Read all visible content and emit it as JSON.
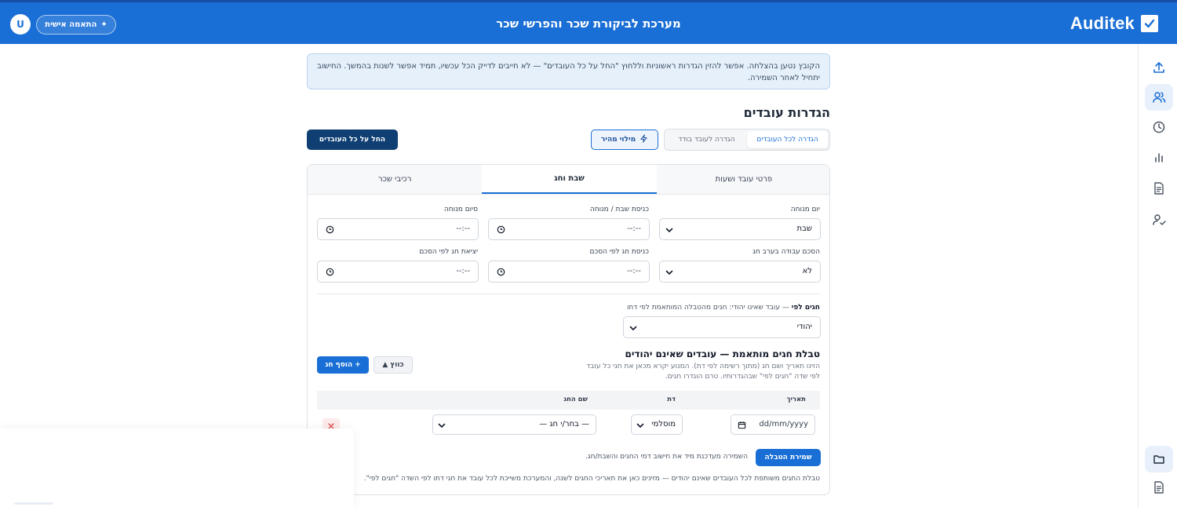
{
  "header": {
    "brand": "Auditek",
    "title": "מערכת לביקורת שכר והפרשי שכר",
    "personal_button": "התאמה אישית",
    "avatar_initial": "U"
  },
  "alert": {
    "text": "הקובץ נטען בהצלחה. אפשר להזין הגדרות ראשוניות וללחוץ \"החל על כל העובדים\" — לא חייבים לדייק הכל עכשיו, תמיד אפשר לשנות בהמשך. החישוב יתחיל לאחר השמירה."
  },
  "page": {
    "title": "הגדרות עובדים",
    "mode_tabs": [
      "הגדרה לכל העובדים",
      "הגדרה לעובד בודד"
    ],
    "quick_fill": "מילוי מהיר",
    "apply_all": "החל על כל העובדים"
  },
  "tabs": [
    "פרטי עובד ושעות",
    "שבת וחג",
    "רכיבי שכר"
  ],
  "fields": {
    "rest_day": {
      "label": "יום מנוחה",
      "value": "שבת"
    },
    "shabbat_entry": {
      "label": "כניסת שבת / מנוחה",
      "value": "--:--"
    },
    "rest_end": {
      "label": "סיום מנוחה",
      "value": "--:--"
    },
    "eve_work": {
      "label": "הסכם עבודה בערב חג",
      "value": "לא"
    },
    "holiday_entry": {
      "label": "כניסת חג לפי הסכם",
      "value": "--:--"
    },
    "holiday_exit": {
      "label": "יציאת חג לפי הסכם",
      "value": "--:--"
    }
  },
  "holidays_by": {
    "label_bold": "חגים לפי",
    "label_rest": " — עובד שאינו יהודי: חגים מהטבלה המותאמת לפי דתו",
    "value": "יהודי"
  },
  "custom_table": {
    "title": "טבלת חגים מותאמת — עובדים שאינם יהודים",
    "description": "הזינו תאריך ושם חג (מתוך רשימה לפי דת). המנוע יקרא מכאן את חגי כל עובד לפי שדה \"חגים לפי\" שבהגדרותיו. טרם הוגדרו חגים.",
    "collapse": "כווץ",
    "add": "הוסף חג",
    "columns": [
      "תאריך",
      "דת",
      "שם החג"
    ],
    "row": {
      "date": "dd/mm/yyyy",
      "religion": "מוסלמי",
      "holiday": "— בחר/י חג —"
    },
    "save": "שמירת הטבלה",
    "save_note": "השמירה מעדכנת מיד את חישוב דמי החגים והשבת/חג.",
    "footer": "טבלת החגים משותפת לכל העובדים שאינם יהודים — מזינים כאן את תאריכי החגים לשנה, והמערכת משייכת לכל עובד את חגי דתו לפי השדה \"חגים לפי\"."
  },
  "rail": {
    "icons": [
      "upload-icon",
      "users-icon",
      "clock-icon",
      "bar-chart-icon",
      "document-icon",
      "user-check-icon",
      "folder-icon",
      "file-icon"
    ],
    "active": "users-icon"
  },
  "colors": {
    "primary": "#1a6fd6",
    "dark_button": "#0f3f73",
    "alert_bg": "#e6f0fb"
  }
}
